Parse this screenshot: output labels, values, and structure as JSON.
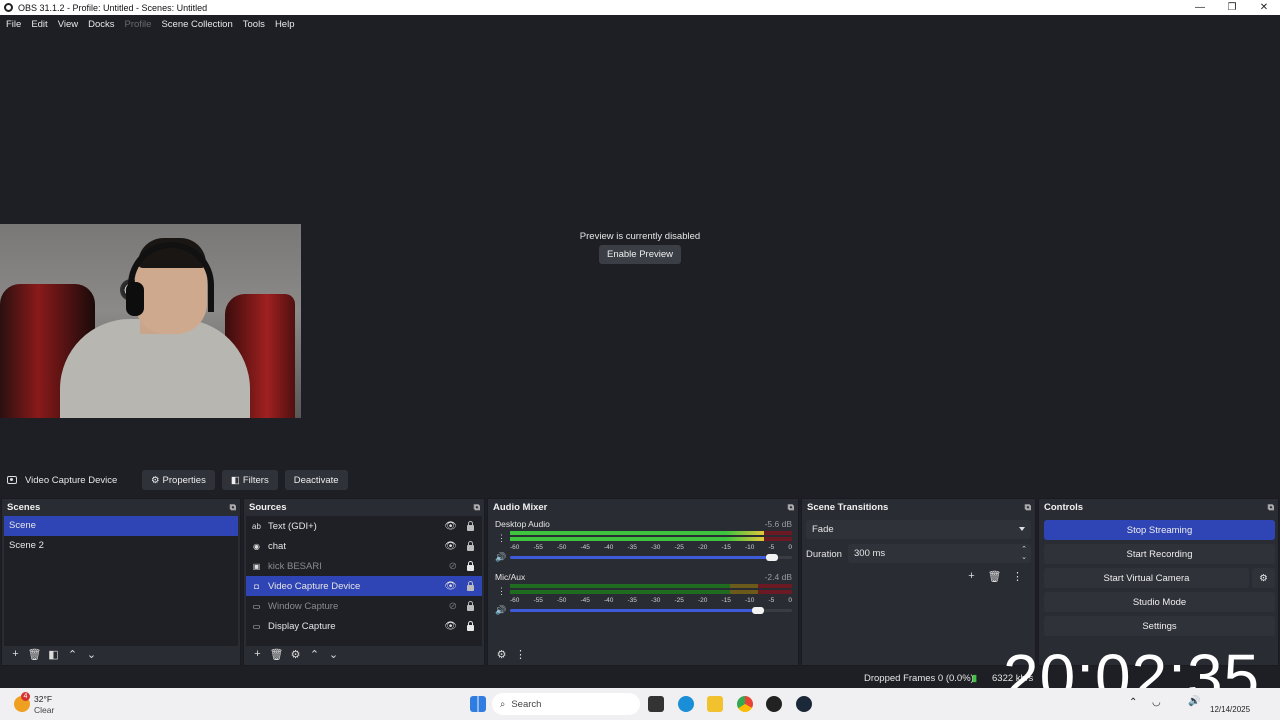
{
  "titlebar": {
    "title": "OBS 31.1.2 - Profile: Untitled - Scenes: Untitled",
    "minimize": "—",
    "restore": "❐",
    "close": "✕"
  },
  "menu": [
    "File",
    "Edit",
    "View",
    "Docks",
    "Profile",
    "Scene Collection",
    "Tools",
    "Help"
  ],
  "preview": {
    "message": "Preview is currently disabled",
    "enable_button": "Enable Preview"
  },
  "context": {
    "source_name": "Video Capture Device",
    "properties": "Properties",
    "filters": "Filters",
    "deactivate": "Deactivate"
  },
  "scenes": {
    "title": "Scenes",
    "items": [
      "Scene",
      "Scene 2"
    ],
    "selected_index": 0
  },
  "sources": {
    "title": "Sources",
    "items": [
      {
        "name": "Text (GDI+)",
        "icon": "text-icon",
        "visible": true,
        "locked": false
      },
      {
        "name": "chat",
        "icon": "browser-icon",
        "visible": true,
        "locked": false
      },
      {
        "name": "kick BESARI",
        "icon": "image-icon",
        "visible": false,
        "locked": true
      },
      {
        "name": "Video Capture Device",
        "icon": "camera-icon",
        "visible": true,
        "locked": false
      },
      {
        "name": "Window Capture",
        "icon": "window-icon",
        "visible": false,
        "locked": false
      },
      {
        "name": "Display Capture",
        "icon": "monitor-icon",
        "visible": true,
        "locked": true
      }
    ]
  },
  "audio_mixer": {
    "title": "Audio Mixer",
    "ticks": [
      "-60",
      "-55",
      "-50",
      "-45",
      "-40",
      "-35",
      "-30",
      "-25",
      "-20",
      "-15",
      "-10",
      "-5",
      "0"
    ],
    "channels": [
      {
        "name": "Desktop Audio",
        "db": "-5.6 dB",
        "level": 0.9,
        "volume": 0.93
      },
      {
        "name": "Mic/Aux",
        "db": "-2.4 dB",
        "level": 0.0,
        "volume": 0.88
      }
    ]
  },
  "transitions": {
    "title": "Scene Transitions",
    "selected": "Fade",
    "duration_label": "Duration",
    "duration_value": "300 ms"
  },
  "controls": {
    "title": "Controls",
    "stop_streaming": "Stop Streaming",
    "start_recording": "Start Recording",
    "start_virtual_camera": "Start Virtual Camera",
    "studio_mode": "Studio Mode",
    "settings": "Settings"
  },
  "status": {
    "dropped_frames": "Dropped Frames 0 (0.0%)",
    "bitrate": "6322 kb/s",
    "clock_overlay": "20:02:35"
  },
  "taskbar": {
    "weather_temp": "32°F",
    "weather_desc": "Clear",
    "weather_badge": "4",
    "search_placeholder": "Search",
    "date": "12/14/2025"
  },
  "colors": {
    "accent": "#2f45b5",
    "panel": "#2a2c33",
    "background": "#1e1f24"
  }
}
